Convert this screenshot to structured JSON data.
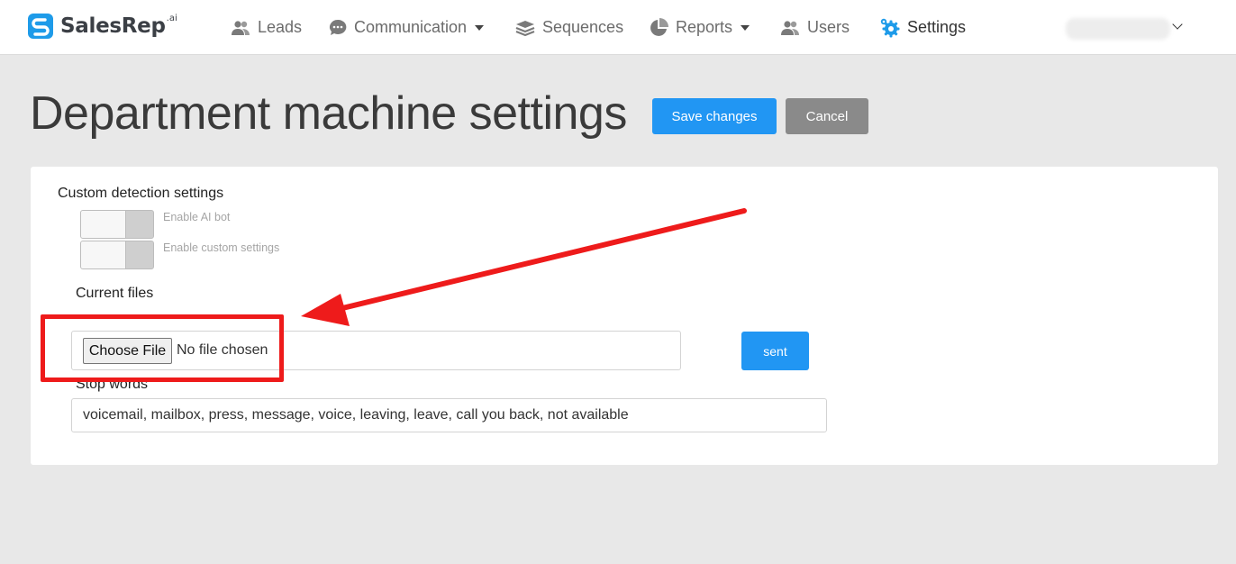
{
  "app": {
    "logo_text": "SalesRep",
    "logo_suffix": ".ai"
  },
  "nav": {
    "items": [
      {
        "label": "Leads",
        "icon": "users-icon"
      },
      {
        "label": "Communication",
        "icon": "chat-bubble-icon",
        "has_dropdown": true
      },
      {
        "label": "Sequences",
        "icon": "layers-icon"
      },
      {
        "label": "Reports",
        "icon": "pie-chart-icon",
        "has_dropdown": true
      },
      {
        "label": "Users",
        "icon": "users-icon"
      },
      {
        "label": "Settings",
        "icon": "gears-icon",
        "active": true
      }
    ]
  },
  "page": {
    "title": "Department machine settings",
    "save_label": "Save changes",
    "cancel_label": "Cancel"
  },
  "settings": {
    "custom_detection_label": "Custom detection settings",
    "toggles": [
      {
        "label": "Enable AI bot",
        "on": false
      },
      {
        "label": "Enable custom settings",
        "on": false
      }
    ],
    "current_files_label": "Current files",
    "file_input": {
      "button_label": "Choose File",
      "status": "No file chosen"
    },
    "sent_label": "sent",
    "stop_words_label": "Stop words",
    "stop_words_value": "voicemail, mailbox, press, message, voice, leaving, leave, call you back, not available"
  },
  "colors": {
    "primary": "#2196f3",
    "secondary": "#8a8a8a",
    "annotation": "#ee1b1b",
    "logo_accent": "#1e9be9"
  }
}
